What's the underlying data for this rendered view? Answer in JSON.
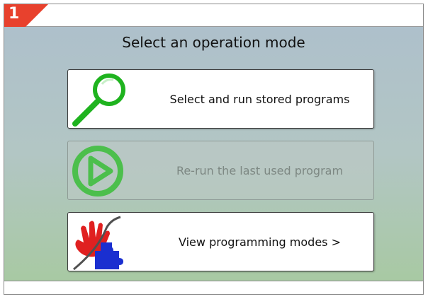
{
  "badge": {
    "number": "1"
  },
  "title": "Select an operation mode",
  "options": [
    {
      "label": "Select and run stored programs",
      "icon": "magnifier-icon",
      "enabled": true
    },
    {
      "label": "Re-run the last used program",
      "icon": "play-icon",
      "enabled": false
    },
    {
      "label": "View programming modes >",
      "icon": "hand-puzzle-icon",
      "enabled": true
    }
  ],
  "colors": {
    "badge": "#e8412d",
    "magnifier": "#1fb31f",
    "play": "#4cbf4c",
    "hand": "#e02020",
    "puzzle": "#1a2fd0"
  }
}
